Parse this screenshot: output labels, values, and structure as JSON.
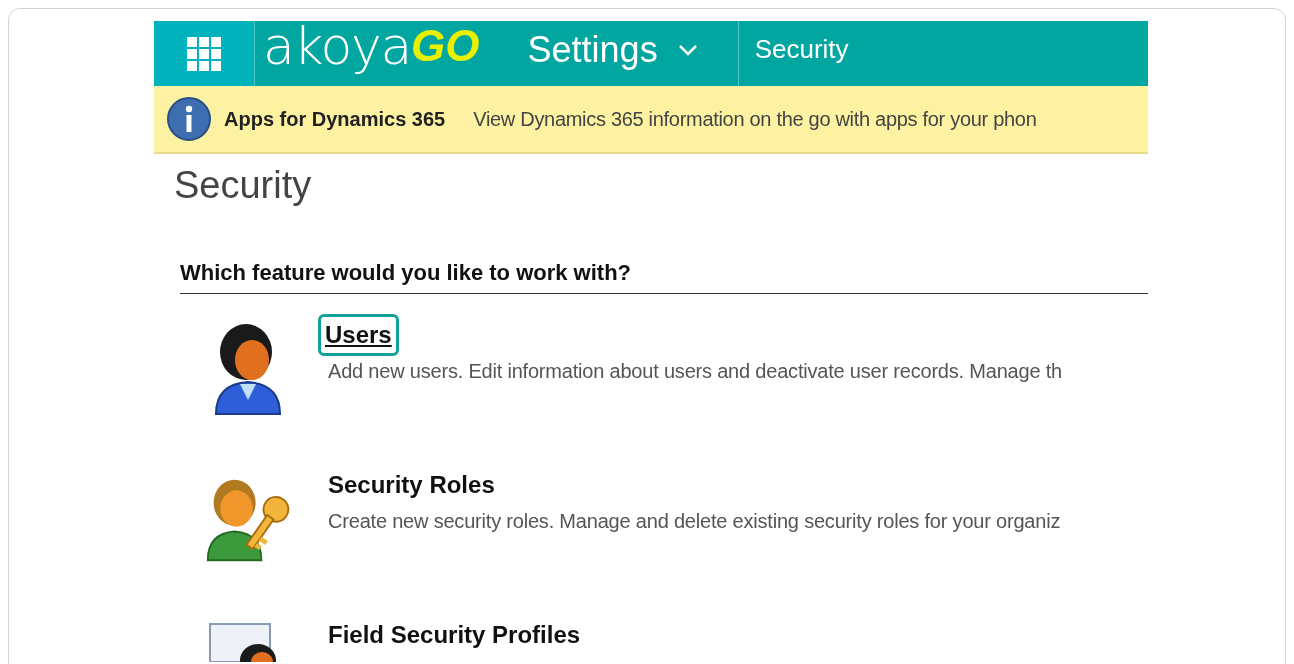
{
  "nav": {
    "logo_main": "akoya",
    "logo_accent": "GO",
    "section": "Settings",
    "page": "Security"
  },
  "banner": {
    "title": "Apps for Dynamics 365",
    "text": "View Dynamics 365 information on the go with apps for your phon"
  },
  "heading": "Security",
  "prompt": "Which feature would you like to work with?",
  "features": [
    {
      "kind": "user",
      "title": "Users",
      "description": "Add new users. Edit information about users and deactivate user records. Manage th",
      "highlighted": true
    },
    {
      "kind": "role",
      "title": "Security Roles",
      "description": "Create new security roles. Manage and delete existing security roles for your organiz",
      "highlighted": false
    },
    {
      "kind": "profile",
      "title": "Field Security Profiles",
      "highlighted": false
    }
  ]
}
